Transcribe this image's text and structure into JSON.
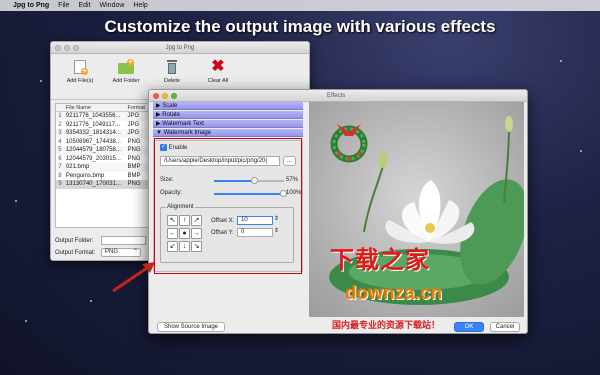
{
  "menubar": {
    "app": "Jpg to Png",
    "items": [
      "File",
      "Edit",
      "Window",
      "Help"
    ]
  },
  "headline": "Customize the output image with various effects",
  "main_window": {
    "title": "Jpg to Png",
    "toolbar": {
      "add_files": "Add File(s)",
      "add_folder": "Add Folder",
      "delete": "Delete",
      "clear_all": "Clear All"
    },
    "table": {
      "headers": [
        "",
        "File Name",
        "Format"
      ],
      "rows": [
        {
          "n": "1",
          "name": "9211776_1043556...",
          "fmt": "JPG"
        },
        {
          "n": "2",
          "name": "9211776_1049117...",
          "fmt": "JPG"
        },
        {
          "n": "3",
          "name": "9354332_1814314...",
          "fmt": "JPG"
        },
        {
          "n": "4",
          "name": "10506967_174438...",
          "fmt": "PNG"
        },
        {
          "n": "5",
          "name": "12044579_180758...",
          "fmt": "PNG"
        },
        {
          "n": "6",
          "name": "12044579_203015...",
          "fmt": "PNG"
        },
        {
          "n": "7",
          "name": "021.bmp",
          "fmt": "BMP"
        },
        {
          "n": "8",
          "name": "Penguins.bmp",
          "fmt": "BMP"
        },
        {
          "n": "9",
          "name": "13130740_170031...",
          "fmt": "PNG"
        }
      ]
    },
    "output_folder_label": "Output Folder:",
    "output_format_label": "Output Format:",
    "output_format_value": "PNG"
  },
  "effects_window": {
    "title": "Effects",
    "sections": {
      "scale": "Scale",
      "rotate": "Rotate",
      "watermark_text": "Watermark Text",
      "watermark_image": "Watermark Image"
    },
    "enable_label": "Enable",
    "path_value": "/Users/apple/Desktop/input/pic/png/20(",
    "browse_label": "...",
    "size_label": "Size:",
    "size_value": "57%",
    "size_fraction": 0.57,
    "opacity_label": "Opacity:",
    "opacity_value": "100%",
    "opacity_fraction": 1.0,
    "alignment_label": "Alignment",
    "offset_x_label": "Offset X:",
    "offset_x_value": "10",
    "offset_y_label": "Offset Y:",
    "offset_y_value": "0",
    "show_source_label": "Show Source Image",
    "ok_label": "OK",
    "cancel_label": "Cancel"
  },
  "watermark_overlay": {
    "line1": "下载之家",
    "line2": "downza.cn",
    "line3": "国内最专业的资源下载站！"
  },
  "colors": {
    "accent": "#2d7cf6",
    "highlight_box": "#d0021b",
    "section_header": "#a5a5f2",
    "arrow": "#c0251e"
  }
}
